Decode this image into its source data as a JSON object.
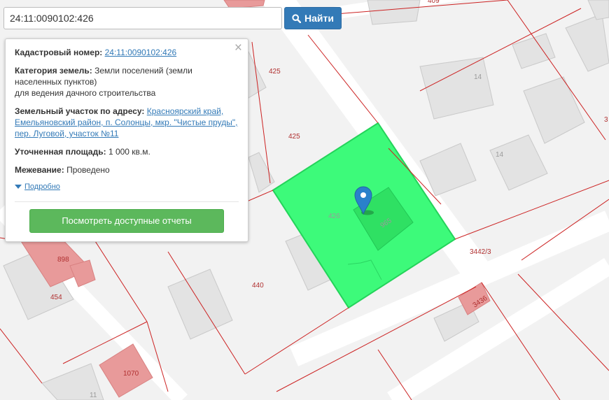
{
  "search": {
    "value": "24:11:0090102:426",
    "button_label": "Найти",
    "button_icon": "search-icon"
  },
  "popup": {
    "cadastral_label": "Кадастровый номер:",
    "cadastral_value": "24:11:0090102:426",
    "category_label": "Категория земель:",
    "category_value_1": "Земли поселений (земли",
    "category_value_2": "населенных пунктов)",
    "category_value_3": "для ведения дачного строительства",
    "address_label": "Земельный участок по адресу:",
    "address_line_1": "Красноярский край,",
    "address_line_2": "Емельяновский район, п. Солонцы, мкр. \"Чистые пруды\",",
    "address_line_3": "пер. Луговой, участок №11",
    "area_label": "Уточненная площадь:",
    "area_value": "1 000 кв.м.",
    "survey_label": "Межевание:",
    "survey_value": "Проведено",
    "details_link": "Подробно",
    "reports_button": "Посмотреть доступные отчеты",
    "close_icon": "close-icon"
  },
  "map": {
    "parcel_labels": [
      "409",
      "425",
      "425",
      "426",
      "965",
      "3442/3",
      "440",
      "898",
      "454",
      "1070",
      "3436",
      "3"
    ],
    "building_labels": [
      "14",
      "14",
      "11"
    ],
    "colors": {
      "background": "#f2f2f2",
      "road": "#ffffff",
      "parcel_border": "#cc2222",
      "building": "#e3e3e3",
      "selected_parcel": "#3dfa7a",
      "red_building": "#e89a9a",
      "marker": "#2a81cb"
    },
    "marker_icon": "map-marker-icon"
  }
}
